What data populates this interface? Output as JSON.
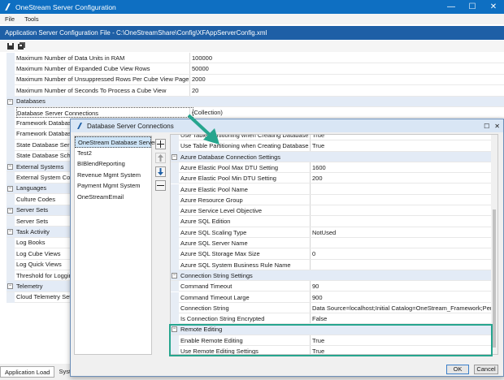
{
  "window": {
    "title": "OneStream Server Configuration"
  },
  "menu": [
    "File",
    "Tools"
  ],
  "filebar": "Application Server Configuration File - C:\\OneStreamShare\\Config\\XFAppServerConfig.xml",
  "background_rows": [
    {
      "type": "prop",
      "name": "Maximum Number of Data Units in RAM",
      "value": "100000"
    },
    {
      "type": "prop",
      "name": "Maximum Number of Expanded Cube View Rows",
      "value": "50000"
    },
    {
      "type": "prop",
      "name": "Maximum Number of Unsuppressed Rows Per Cube View Page",
      "value": "2000"
    },
    {
      "type": "prop",
      "name": "Maximum Number of Seconds To Process a Cube View",
      "value": "20"
    },
    {
      "type": "cat",
      "name": "Databases",
      "value": ""
    },
    {
      "type": "prop",
      "name": "Database Server Connections",
      "value": "(Collection)",
      "selected": true
    },
    {
      "type": "prop",
      "name": "Framework Database",
      "value": ""
    },
    {
      "type": "prop",
      "name": "Framework Database",
      "value": ""
    },
    {
      "type": "prop",
      "name": "State Database Ser",
      "value": ""
    },
    {
      "type": "prop",
      "name": "State Database Scher",
      "value": ""
    },
    {
      "type": "cat",
      "name": "External Systems",
      "value": ""
    },
    {
      "type": "prop",
      "name": "External System Conn",
      "value": ""
    },
    {
      "type": "cat",
      "name": "Languages",
      "value": ""
    },
    {
      "type": "prop",
      "name": "Culture Codes",
      "value": ""
    },
    {
      "type": "cat",
      "name": "Server Sets",
      "value": ""
    },
    {
      "type": "prop",
      "name": "Server Sets",
      "value": ""
    },
    {
      "type": "cat",
      "name": "Task Activity",
      "value": ""
    },
    {
      "type": "prop",
      "name": "Log Books",
      "value": ""
    },
    {
      "type": "prop",
      "name": "Log Cube Views",
      "value": ""
    },
    {
      "type": "prop",
      "name": "Log Quick Views",
      "value": ""
    },
    {
      "type": "prop",
      "name": "Threshold for Loggin",
      "value": ""
    },
    {
      "type": "cat",
      "name": "Telemetry",
      "value": ""
    },
    {
      "type": "prop",
      "name": "Cloud Telemetry Sett",
      "value": ""
    }
  ],
  "bottom_tabs": [
    "Application Load",
    "System Conf"
  ],
  "dialog": {
    "title": "Database Server Connections",
    "list": [
      "OneStream Database Server",
      "Test2",
      "BIBlendReporting",
      "Revenue Mgmt System",
      "Payment Mgmt System",
      "OneStreamEmail"
    ],
    "rows": [
      {
        "type": "prop",
        "name": "Use Table Partitioning when Creating Databases",
        "value": "True"
      },
      {
        "type": "prop",
        "name": "Use Table Partitioning when Creating Databases",
        "value": "True"
      },
      {
        "type": "cat",
        "name": "Azure Database Connection Settings",
        "value": ""
      },
      {
        "type": "prop",
        "name": "Azure Elastic Pool Max DTU Setting",
        "value": "1600"
      },
      {
        "type": "prop",
        "name": "Azure Elastic Pool Min DTU Setting",
        "value": "200"
      },
      {
        "type": "prop",
        "name": "Azure Elastic Pool Name",
        "value": ""
      },
      {
        "type": "prop",
        "name": "Azure Resource Group",
        "value": ""
      },
      {
        "type": "prop",
        "name": "Azure Service Level Objective",
        "value": ""
      },
      {
        "type": "prop",
        "name": "Azure SQL Edition",
        "value": ""
      },
      {
        "type": "prop",
        "name": "Azure SQL Scaling Type",
        "value": "NotUsed"
      },
      {
        "type": "prop",
        "name": "Azure SQL Server Name",
        "value": ""
      },
      {
        "type": "prop",
        "name": "Azure SQL Storage Max Size",
        "value": "0"
      },
      {
        "type": "prop",
        "name": "Azure SQL System Business Rule Name",
        "value": ""
      },
      {
        "type": "cat",
        "name": "Connection String Settings",
        "value": ""
      },
      {
        "type": "prop",
        "name": "Command Timeout",
        "value": "90"
      },
      {
        "type": "prop",
        "name": "Command Timeout Large",
        "value": "900"
      },
      {
        "type": "prop",
        "name": "Connection String",
        "value": "Data Source=localhost;Initial Catalog=OneStream_Framework;Persist S"
      },
      {
        "type": "prop",
        "name": "Is Connection String Encrypted",
        "value": "False"
      },
      {
        "type": "cat",
        "name": "Remote Editing",
        "value": ""
      },
      {
        "type": "prop",
        "name": "Enable Remote Editing",
        "value": "True"
      },
      {
        "type": "prop",
        "name": "Use Remote Editing Settings",
        "value": "True"
      }
    ],
    "ok": "OK",
    "cancel": "Cancel"
  },
  "colors": {
    "titlebar": "#0e6fc2",
    "filebar": "#1e5fa6",
    "highlight": "#26a58e"
  }
}
